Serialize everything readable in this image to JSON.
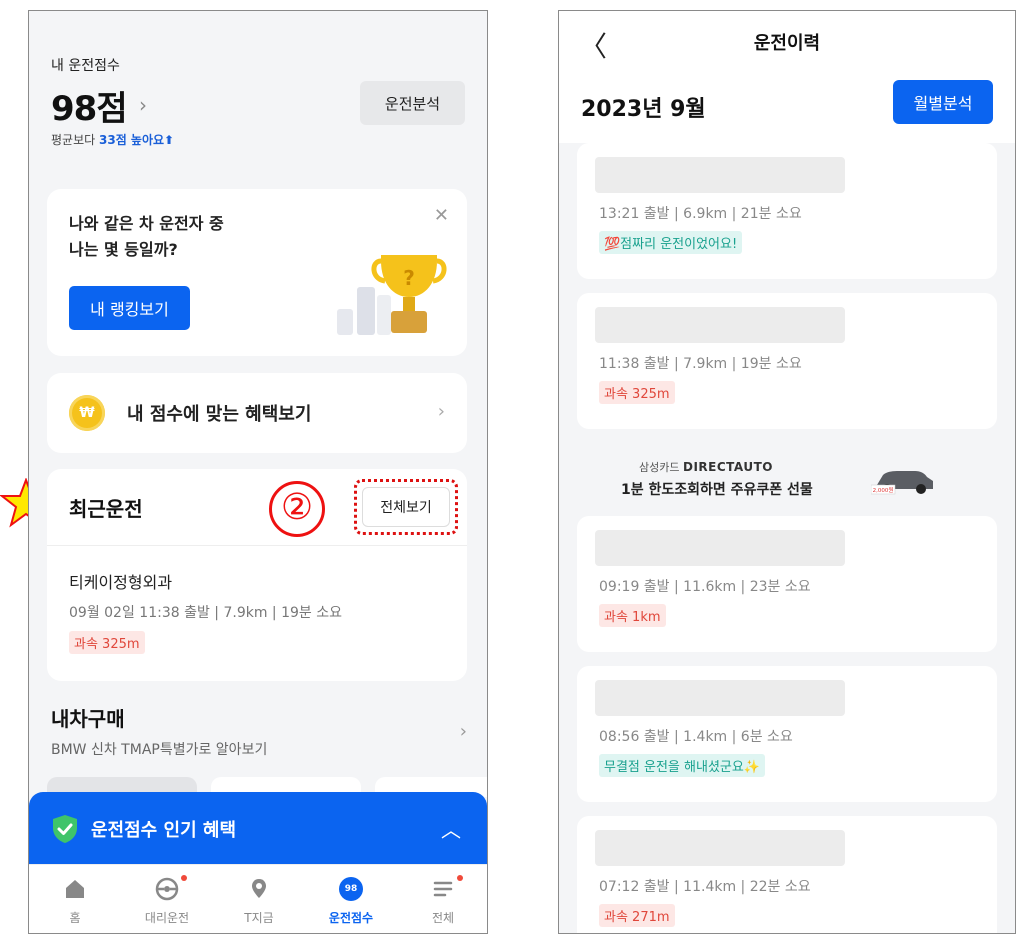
{
  "left": {
    "score": {
      "label": "내 운전점수",
      "value": "98점",
      "chevron": "›",
      "sub_prefix": "평균보다",
      "sub_highlight": "33점 높아요",
      "sub_arrow": "⬆",
      "analyze_button": "운전분석"
    },
    "rank_card": {
      "title_line1": "나와 같은 차 운전자 중",
      "title_line2": "나는 몇 등일까?",
      "close": "✕",
      "button": "내 랭킹보기",
      "trophy_mark": "?"
    },
    "benefit_card": {
      "coin": "₩",
      "text": "내 점수에 맞는 혜택보기",
      "chevron": "›"
    },
    "recent": {
      "title": "최근운전",
      "annotation_number": "②",
      "view_all": "전체보기",
      "place": "티케이정형외과",
      "meta": "09월 02일 11:38 출발 | 7.9km | 19분 소요",
      "tag": "과속 325m"
    },
    "car": {
      "title": "내차구매",
      "subtitle": "BMW 신차 TMAP특별가로 알아보기",
      "chevron": "›"
    },
    "popular": {
      "text": "운전점수 인기 혜택",
      "chevron": "︿"
    },
    "tabs": [
      {
        "label": "홈",
        "icon": "home-icon"
      },
      {
        "label": "대리운전",
        "icon": "steering-wheel-icon"
      },
      {
        "label": "T지금",
        "icon": "location-pin-icon"
      },
      {
        "label": "운전점수",
        "icon": "score-badge-icon",
        "badge": "98"
      },
      {
        "label": "전체",
        "icon": "menu-icon"
      }
    ]
  },
  "right": {
    "back": "〈",
    "title": "운전이력",
    "month": "2023년 9월",
    "monthly_button": "월별분석",
    "trips": [
      {
        "meta": "13:21 출발 | 6.9km | 21분 소요",
        "tag": "💯점짜리 운전이었어요!",
        "tag_type": "good"
      },
      {
        "meta": "11:38 출발 | 7.9km | 19분 소요",
        "tag": "과속 325m",
        "tag_type": "speed"
      },
      {
        "meta": "09:19 출발 | 11.6km | 23분 소요",
        "tag": "과속 1km",
        "tag_type": "speed"
      },
      {
        "meta": "08:56 출발 | 1.4km | 6분 소요",
        "tag": "무결점 운전을 해내셨군요✨",
        "tag_type": "good"
      },
      {
        "meta": "07:12 출발 | 11.4km | 22분 소요",
        "tag": "과속 271m",
        "tag_type": "speed"
      }
    ],
    "ad": {
      "brand_small": "삼성카드",
      "brand": "DIRECTAUTO",
      "text": "1분 한도조회하면 주유쿠폰 선물",
      "badge_text": "2,000원"
    }
  },
  "colors": {
    "primary": "#0b64f0",
    "speed_tag_bg": "#fde7e5",
    "speed_tag_fg": "#e0473b",
    "good_tag_bg": "#dff5f2",
    "good_tag_fg": "#19a18e",
    "annotation_red": "#e11111",
    "star_yellow": "#ffe800"
  }
}
